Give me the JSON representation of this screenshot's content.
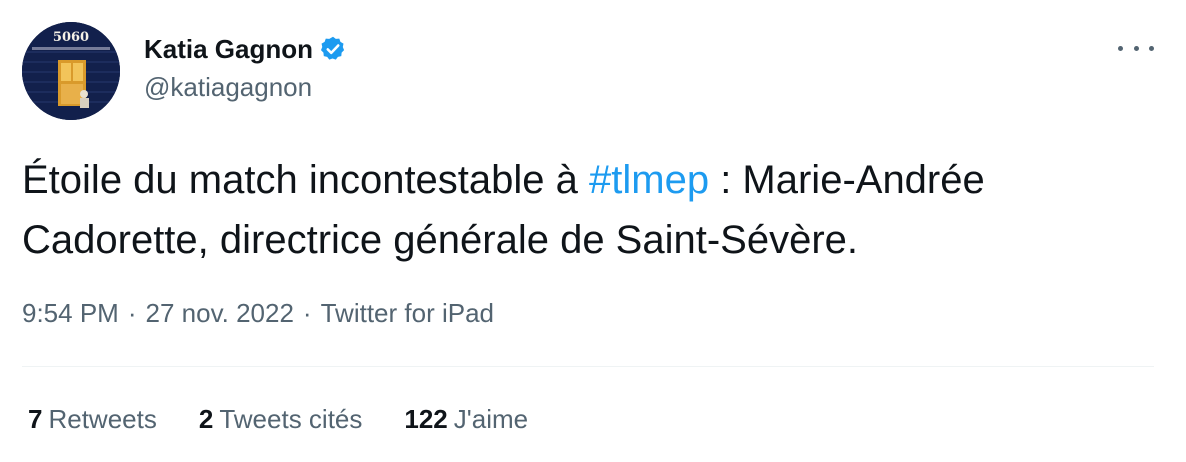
{
  "author": {
    "name": "Katia Gagnon",
    "handle": "@katiagagnon",
    "avatar_text": "5060",
    "verified_color": "#1d9bf0"
  },
  "more_menu": {
    "icon": "more-horizontal-icon"
  },
  "tweet": {
    "text_before": "Étoile du match incontestable à ",
    "hashtag": "#tlmep",
    "text_after": " : Marie-Andrée Cadorette, directrice générale de Saint-Sévère."
  },
  "meta": {
    "time": "9:54 PM",
    "separator": "·",
    "date": "27 nov. 2022",
    "source": "Twitter for iPad"
  },
  "stats": {
    "retweets": {
      "count": "7",
      "label": "Retweets"
    },
    "quotes": {
      "count": "2",
      "label": "Tweets cités"
    },
    "likes": {
      "count": "122",
      "label": "J'aime"
    }
  },
  "colors": {
    "text": "#0f1419",
    "secondary": "#536471",
    "accent": "#1d9bf0",
    "divider": "#eff3f4"
  }
}
